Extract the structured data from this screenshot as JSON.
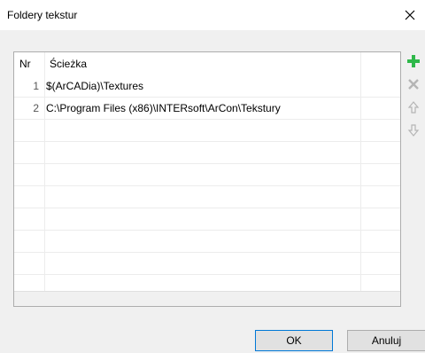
{
  "dialog": {
    "title": "Foldery tekstur"
  },
  "table": {
    "headers": {
      "nr": "Nr",
      "path": "Ścieżka"
    },
    "rows": [
      {
        "nr": "1",
        "path": "$(ArCADia)\\Textures"
      },
      {
        "nr": "2",
        "path": "C:\\Program Files (x86)\\INTERsoft\\ArCon\\Tekstury"
      }
    ]
  },
  "toolbar": {
    "icons": [
      "add-icon",
      "delete-icon",
      "move-up-icon",
      "move-down-icon"
    ],
    "colors": {
      "add": "#2fb84a",
      "disabled": "#b5b5b5"
    }
  },
  "buttons": {
    "ok": "OK",
    "cancel": "Anuluj"
  }
}
